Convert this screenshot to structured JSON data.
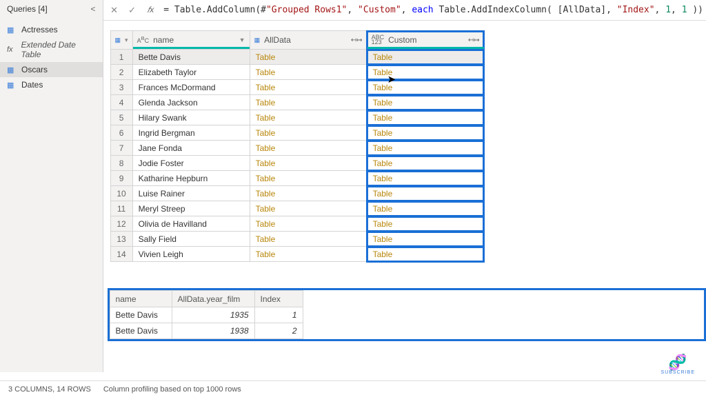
{
  "sidebar": {
    "title": "Queries [4]",
    "items": [
      {
        "label": "Actresses",
        "icon": "▦"
      },
      {
        "label": "Extended Date Table",
        "icon": "fx"
      },
      {
        "label": "Oscars",
        "icon": "▦"
      },
      {
        "label": "Dates",
        "icon": "▦"
      }
    ]
  },
  "formula": {
    "prefix": "= Table.AddColumn(#",
    "str1": "\"Grouped Rows1\"",
    "sep1": ", ",
    "str2": "\"Custom\"",
    "sep2": ", ",
    "kw": "each",
    "mid": " Table.AddIndexColumn( [AllData], ",
    "str3": "\"Index\"",
    "sep3": ", ",
    "num1": "1",
    "sep4": ", ",
    "num2": "1",
    "end": " ))"
  },
  "columns": {
    "name": "name",
    "alldata": "AllData",
    "custom": "Custom",
    "name_type": "ABC",
    "custom_type": "ABC\n123",
    "expand_glyph": "↤↦",
    "dropdown_glyph": "▼"
  },
  "tableLink": "Table",
  "rows": [
    {
      "n": "1",
      "name": "Bette Davis"
    },
    {
      "n": "2",
      "name": "Elizabeth Taylor"
    },
    {
      "n": "3",
      "name": "Frances McDormand"
    },
    {
      "n": "4",
      "name": "Glenda Jackson"
    },
    {
      "n": "5",
      "name": "Hilary Swank"
    },
    {
      "n": "6",
      "name": "Ingrid Bergman"
    },
    {
      "n": "7",
      "name": "Jane Fonda"
    },
    {
      "n": "8",
      "name": "Jodie Foster"
    },
    {
      "n": "9",
      "name": "Katharine Hepburn"
    },
    {
      "n": "10",
      "name": "Luise Rainer"
    },
    {
      "n": "11",
      "name": "Meryl Streep"
    },
    {
      "n": "12",
      "name": "Olivia de Havilland"
    },
    {
      "n": "13",
      "name": "Sally Field"
    },
    {
      "n": "14",
      "name": "Vivien Leigh"
    }
  ],
  "preview": {
    "headers": {
      "name": "name",
      "year": "AllData.year_film",
      "index": "Index"
    },
    "rows": [
      {
        "name": "Bette Davis",
        "year": "1935",
        "index": "1"
      },
      {
        "name": "Bette Davis",
        "year": "1938",
        "index": "2"
      }
    ]
  },
  "status": {
    "cols_rows": "3 COLUMNS, 14 ROWS",
    "profile": "Column profiling based on top 1000 rows"
  },
  "subscribe": "SUBSCRIBE"
}
